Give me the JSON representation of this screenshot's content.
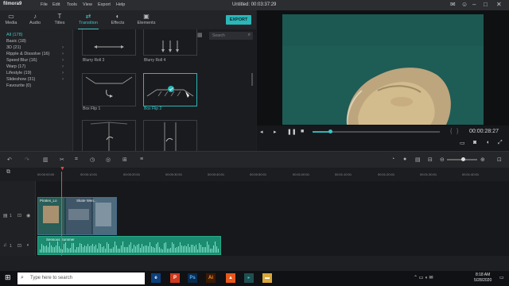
{
  "app": {
    "name": "filmora9",
    "title": "Untitled:",
    "timecode": "00:03:37:29"
  },
  "menu": [
    "File",
    "Edit",
    "Tools",
    "View",
    "Export",
    "Help"
  ],
  "tabs": [
    {
      "label": "Media",
      "icon": "folder-icon"
    },
    {
      "label": "Audio",
      "icon": "music-icon"
    },
    {
      "label": "Titles",
      "icon": "text-icon"
    },
    {
      "label": "Transition",
      "icon": "transition-icon",
      "active": true
    },
    {
      "label": "Effects",
      "icon": "effects-icon"
    },
    {
      "label": "Elements",
      "icon": "elements-icon"
    }
  ],
  "export_label": "EXPORT",
  "search_placeholder": "Search",
  "categories": [
    {
      "label": "All (178)",
      "selected": true
    },
    {
      "label": "Basic (18)",
      "arrow": false
    },
    {
      "label": "3D (21)",
      "arrow": true
    },
    {
      "label": "Ripple & Dissolve (16)",
      "arrow": true
    },
    {
      "label": "Speed Blur (16)",
      "arrow": true
    },
    {
      "label": "Warp (17)",
      "arrow": true
    },
    {
      "label": "Lifestyle (19)",
      "arrow": true
    },
    {
      "label": "Slideshow (31)",
      "arrow": true
    },
    {
      "label": "Favourite (0)",
      "arrow": false
    }
  ],
  "transitions": [
    {
      "label": "Blurry Roll 3"
    },
    {
      "label": "Blurry Roll 4"
    },
    {
      "label": "Box Flip 1"
    },
    {
      "label": "Box Flip 2",
      "selected": true
    },
    {
      "label": ""
    },
    {
      "label": ""
    }
  ],
  "preview": {
    "time": "00:00:28:27",
    "progress": 0.14
  },
  "timeline": {
    "ruler": [
      "00:00:00:00",
      "00:00:10:01",
      "00:00:20:01",
      "00:00:30:01",
      "00:00:40:01",
      "00:00:50:01",
      "00:01:00:01",
      "00:01:10:01",
      "00:01:20:01",
      "00:01:30:01",
      "00:01:40:01",
      "00:01:50:01"
    ],
    "video_clip_label": "Pirates_Lo",
    "video_clip_label2": "Skate Wen...",
    "audio_clip_label": "Sensous Summer",
    "track_video": "1",
    "track_audio": "1"
  },
  "taskbar": {
    "search": "Type here to search",
    "time": "8:18 AM",
    "date": "5/28/2020"
  },
  "colors": {
    "accent": "#2bb6b8",
    "playhead": "#e24b4b"
  }
}
